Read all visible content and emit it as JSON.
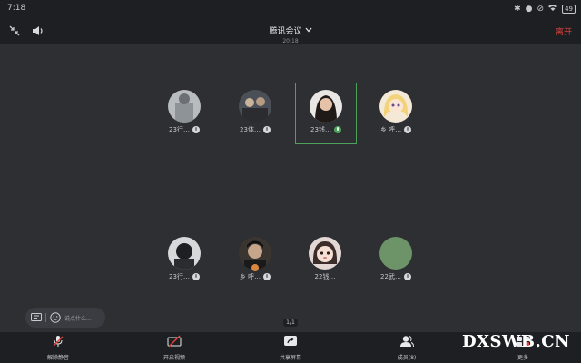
{
  "status": {
    "time": "7:18",
    "battery": "49"
  },
  "header": {
    "title": "腾讯会议",
    "timer": "20:18",
    "leave_label": "离开"
  },
  "participants": [
    {
      "name": "23行…",
      "mic": "muted",
      "active": false,
      "avatar": "grey-shirt"
    },
    {
      "name": "23体…",
      "mic": "muted",
      "active": false,
      "avatar": "dark-group"
    },
    {
      "name": "23钱…",
      "mic": "on",
      "active": true,
      "avatar": "girl-portrait"
    },
    {
      "name": "乡 呼…",
      "mic": "muted",
      "active": false,
      "avatar": "anime-girl"
    },
    {
      "name": "23行…",
      "mic": "muted",
      "active": false,
      "avatar": "masked-person"
    },
    {
      "name": "乡 呼…",
      "mic": "muted",
      "active": false,
      "avatar": "dark-face",
      "speaker": true
    },
    {
      "name": "22钱…",
      "mic": "none",
      "active": false,
      "avatar": "cartoon-girl"
    },
    {
      "name": "22武…",
      "mic": "muted",
      "active": false,
      "avatar": "green-solid"
    }
  ],
  "chat": {
    "placeholder": "说点什么..."
  },
  "page": {
    "indicator": "1/1"
  },
  "toolbar": {
    "unmute_label": "解除静音",
    "video_label": "开启视频",
    "share_label": "共享屏幕",
    "members_label": "成员(8)",
    "more_label": "更多"
  },
  "watermark": "DXSWB.CN",
  "colors": {
    "leave": "#e0433c",
    "active_border": "#4ea15a",
    "background": "#2e2f33",
    "bar": "#1e1f22"
  }
}
